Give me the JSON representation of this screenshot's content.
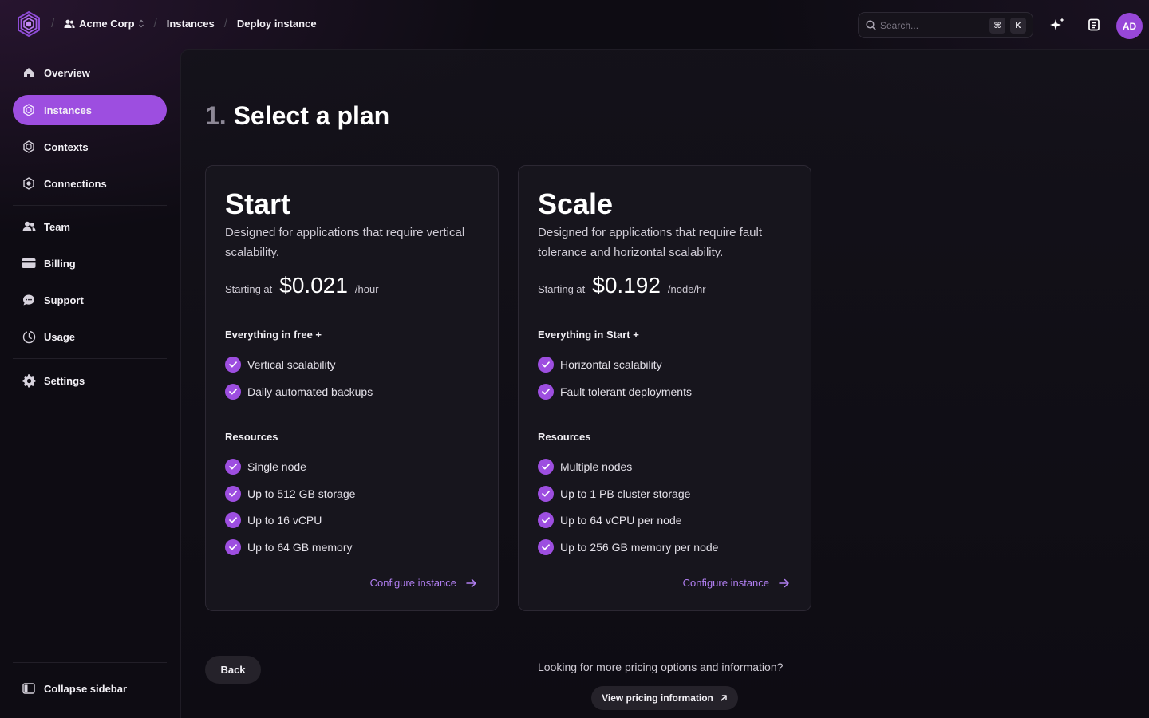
{
  "breadcrumb": {
    "org": "Acme Corp",
    "section": "Instances",
    "page": "Deploy instance"
  },
  "search": {
    "placeholder": "Search...",
    "shortcut_mod": "⌘",
    "shortcut_key": "K"
  },
  "user": {
    "initials": "AD"
  },
  "sidebar": {
    "items": [
      {
        "label": "Overview",
        "icon": "home-icon"
      },
      {
        "label": "Instances",
        "icon": "instances-icon",
        "active": true
      },
      {
        "label": "Contexts",
        "icon": "contexts-icon"
      },
      {
        "label": "Connections",
        "icon": "connections-icon"
      },
      {
        "label": "Team",
        "icon": "team-icon"
      },
      {
        "label": "Billing",
        "icon": "credit-card-icon"
      },
      {
        "label": "Support",
        "icon": "chat-bubble-icon"
      },
      {
        "label": "Usage",
        "icon": "clock-icon"
      },
      {
        "label": "Settings",
        "icon": "gear-icon"
      }
    ],
    "collapse_label": "Collapse sidebar"
  },
  "heading": {
    "step": "1.",
    "title": "Select a plan"
  },
  "plans": [
    {
      "name": "Start",
      "description": "Designed for applications that require vertical scalability.",
      "price_prefix": "Starting at",
      "price": "$0.021",
      "price_unit": "/hour",
      "features_heading": "Everything in free +",
      "features": [
        "Vertical scalability",
        "Daily automated backups"
      ],
      "resources_heading": "Resources",
      "resources": [
        "Single node",
        "Up to 512 GB storage",
        "Up to 16 vCPU",
        "Up to 64 GB memory"
      ],
      "cta": "Configure instance"
    },
    {
      "name": "Scale",
      "description": "Designed for applications that require fault tolerance and horizontal scalability.",
      "price_prefix": "Starting at",
      "price": "$0.192",
      "price_unit": "/node/hr",
      "features_heading": "Everything in Start +",
      "features": [
        "Horizontal scalability",
        "Fault tolerant deployments"
      ],
      "resources_heading": "Resources",
      "resources": [
        "Multiple nodes",
        "Up to 1 PB cluster storage",
        "Up to 64 vCPU per node",
        "Up to 256 GB memory per node"
      ],
      "cta": "Configure instance"
    }
  ],
  "footer": {
    "back_label": "Back",
    "pricing_question": "Looking for more pricing options and information?",
    "pricing_button": "View pricing information"
  },
  "colors": {
    "accent": "#9d4ee0",
    "link": "#b07ef0",
    "background": "#0e0c13",
    "card": "#17151d"
  }
}
